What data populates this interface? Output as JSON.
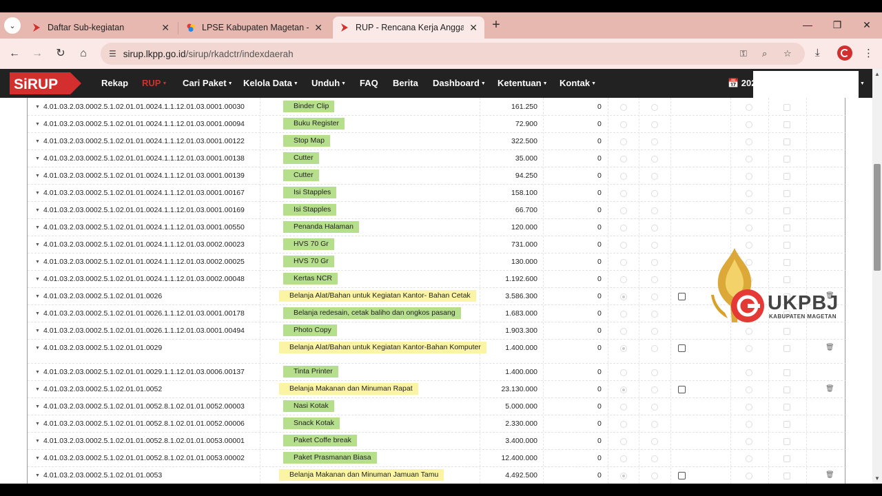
{
  "browser": {
    "tabs": [
      {
        "title": "Daftar Sub-kegiatan",
        "close": "✕",
        "active": false
      },
      {
        "title": "LPSE Kabupaten Magetan - Ber",
        "close": "✕",
        "active": false
      },
      {
        "title": "RUP - Rencana Kerja Anggaran",
        "close": "✕",
        "active": true
      }
    ],
    "new_tab": "+",
    "url_host": "sirup.lkpp.go.id",
    "url_path": "/sirup/rkadctr/indexdaerah",
    "tab_menu": "⌄",
    "win_min": "—",
    "win_restore": "❐",
    "win_close": "✕"
  },
  "site": {
    "logo_text": "SiRUP",
    "nav": [
      {
        "label": "Rekap",
        "caret": false,
        "active": false
      },
      {
        "label": "RUP",
        "caret": true,
        "active": true
      },
      {
        "label": "Cari Paket",
        "caret": true,
        "active": false
      },
      {
        "label": "Kelola Data",
        "caret": true,
        "active": false
      },
      {
        "label": "Unduh",
        "caret": true,
        "active": false
      },
      {
        "label": "FAQ",
        "caret": false,
        "active": false
      },
      {
        "label": "Berita",
        "caret": false,
        "active": false
      },
      {
        "label": "Dashboard",
        "caret": true,
        "active": false
      },
      {
        "label": "Ketentuan",
        "caret": true,
        "active": false
      },
      {
        "label": "Kontak",
        "caret": true,
        "active": false
      }
    ],
    "year_label": "📅 202"
  },
  "rows": [
    {
      "code": "4.01.03.2.03.0002.5.1.02.01.01.0024.1.1.12.01.03.0001.00030",
      "name": "Binder Clip",
      "kind": "green",
      "amount": "161.250",
      "value": "0"
    },
    {
      "code": "4.01.03.2.03.0002.5.1.02.01.01.0024.1.1.12.01.03.0001.00094",
      "name": "Buku Register",
      "kind": "green",
      "amount": "72.900",
      "value": "0"
    },
    {
      "code": "4.01.03.2.03.0002.5.1.02.01.01.0024.1.1.12.01.03.0001.00122",
      "name": "Stop Map",
      "kind": "green",
      "amount": "322.500",
      "value": "0"
    },
    {
      "code": "4.01.03.2.03.0002.5.1.02.01.01.0024.1.1.12.01.03.0001.00138",
      "name": "Cutter",
      "kind": "green",
      "amount": "35.000",
      "value": "0"
    },
    {
      "code": "4.01.03.2.03.0002.5.1.02.01.01.0024.1.1.12.01.03.0001.00139",
      "name": "Cutter",
      "kind": "green",
      "amount": "94.250",
      "value": "0"
    },
    {
      "code": "4.01.03.2.03.0002.5.1.02.01.01.0024.1.1.12.01.03.0001.00167",
      "name": "Isi Stapples",
      "kind": "green",
      "amount": "158.100",
      "value": "0"
    },
    {
      "code": "4.01.03.2.03.0002.5.1.02.01.01.0024.1.1.12.01.03.0001.00169",
      "name": "Isi Stapples",
      "kind": "green",
      "amount": "66.700",
      "value": "0"
    },
    {
      "code": "4.01.03.2.03.0002.5.1.02.01.01.0024.1.1.12.01.03.0001.00550",
      "name": "Penanda Halaman",
      "kind": "green",
      "amount": "120.000",
      "value": "0"
    },
    {
      "code": "4.01.03.2.03.0002.5.1.02.01.01.0024.1.1.12.01.03.0002.00023",
      "name": "HVS 70 Gr",
      "kind": "green",
      "amount": "731.000",
      "value": "0"
    },
    {
      "code": "4.01.03.2.03.0002.5.1.02.01.01.0024.1.1.12.01.03.0002.00025",
      "name": "HVS 70 Gr",
      "kind": "green",
      "amount": "130.000",
      "value": "0"
    },
    {
      "code": "4.01.03.2.03.0002.5.1.02.01.01.0024.1.1.12.01.03.0002.00048",
      "name": "Kertas NCR",
      "kind": "green",
      "amount": "1.192.600",
      "value": "0"
    },
    {
      "code": "4.01.03.2.03.0002.5.1.02.01.01.0026",
      "name": "Belanja Alat/Bahan untuk Kegiatan Kantor- Bahan Cetak",
      "kind": "yellow",
      "amount": "3.586.300",
      "value": "0"
    },
    {
      "code": "4.01.03.2.03.0002.5.1.02.01.01.0026.1.1.12.01.03.0001.00178",
      "name": "Belanja redesain, cetak baliho dan ongkos pasang",
      "kind": "green",
      "amount": "1.683.000",
      "value": "0"
    },
    {
      "code": "4.01.03.2.03.0002.5.1.02.01.01.0026.1.1.12.01.03.0001.00494",
      "name": "Photo Copy",
      "kind": "green",
      "amount": "1.903.300",
      "value": "0"
    },
    {
      "code": "4.01.03.2.03.0002.5.1.02.01.01.0029",
      "name": "Belanja Alat/Bahan untuk Kegiatan Kantor-Bahan Komputer",
      "kind": "yellow",
      "amount": "1.400.000",
      "value": "0"
    },
    {
      "code": "4.01.03.2.03.0002.5.1.02.01.01.0029.1.1.12.01.03.0006.00137",
      "name": "Tinta Printer",
      "kind": "green",
      "amount": "1.400.000",
      "value": "0"
    },
    {
      "code": "4.01.03.2.03.0002.5.1.02.01.01.0052",
      "name": "Belanja Makanan dan Minuman Rapat",
      "kind": "yellow",
      "amount": "23.130.000",
      "value": "0"
    },
    {
      "code": "4.01.03.2.03.0002.5.1.02.01.01.0052.8.1.02.01.01.0052.00003",
      "name": "Nasi Kotak",
      "kind": "green",
      "amount": "5.000.000",
      "value": "0"
    },
    {
      "code": "4.01.03.2.03.0002.5.1.02.01.01.0052.8.1.02.01.01.0052.00006",
      "name": "Snack Kotak",
      "kind": "green",
      "amount": "2.330.000",
      "value": "0"
    },
    {
      "code": "4.01.03.2.03.0002.5.1.02.01.01.0052.8.1.02.01.01.0053.00001",
      "name": "Paket Coffe break",
      "kind": "green",
      "amount": "3.400.000",
      "value": "0"
    },
    {
      "code": "4.01.03.2.03.0002.5.1.02.01.01.0052.8.1.02.01.01.0053.00002",
      "name": "Paket Prasmanan Biasa",
      "kind": "green",
      "amount": "12.400.000",
      "value": "0"
    },
    {
      "code": "4.01.03.2.03.0002.5.1.02.01.01.0053",
      "name": "Belanja Makanan dan Minuman Jamuan Tamu",
      "kind": "yellow",
      "amount": "4.492.500",
      "value": "0"
    }
  ],
  "watermark": {
    "brand": "UKPBJ",
    "subtitle": "KABUPATEN MAGETAN"
  },
  "colors": {
    "accent": "#d32f2f",
    "green_pill": "#b6df8c",
    "yellow_pill": "#fbf4a4",
    "navbar": "#222222",
    "tab_bar": "#e6b8b0"
  }
}
